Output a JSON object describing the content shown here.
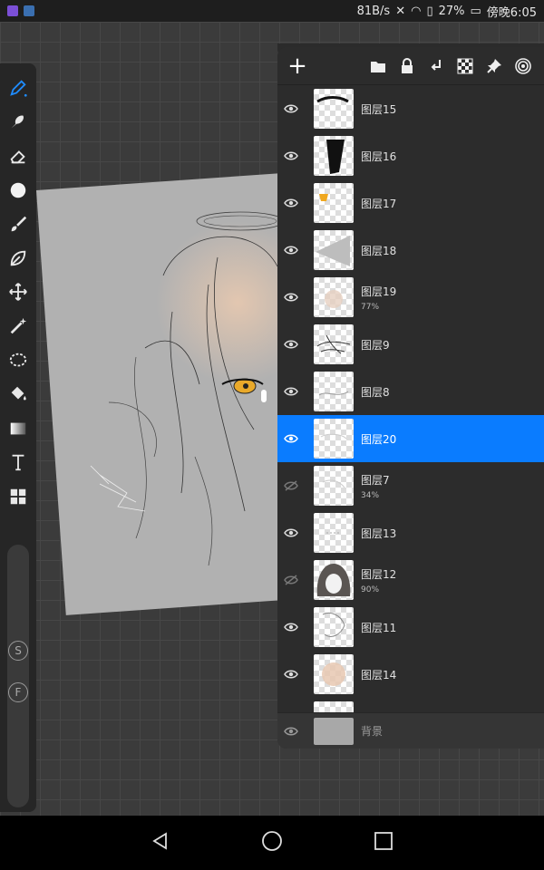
{
  "status_bar": {
    "net_speed": "81B/s",
    "battery": "27%",
    "time": "傍晚6:05"
  },
  "toolbar": {
    "tools": [
      "pen-icon",
      "smudge-icon",
      "eraser-icon",
      "brush-size-icon",
      "brush-icon",
      "leaf-icon",
      "move-icon",
      "magic-wand-icon",
      "lasso-icon",
      "fill-icon",
      "gradient-icon",
      "text-icon",
      "grid-icon"
    ],
    "s_label": "S",
    "f_label": "F"
  },
  "layer_panel": {
    "add_label": "+",
    "header_icons": [
      "folder-icon",
      "lock-icon",
      "merge-down-icon",
      "checker-icon",
      "pin-icon",
      "spiral-icon"
    ],
    "layers": [
      {
        "name": "图层15",
        "opacity": "",
        "visible": true,
        "selected": false
      },
      {
        "name": "图层16",
        "opacity": "",
        "visible": true,
        "selected": false
      },
      {
        "name": "图层17",
        "opacity": "",
        "visible": true,
        "selected": false
      },
      {
        "name": "图层18",
        "opacity": "",
        "visible": true,
        "selected": false
      },
      {
        "name": "图层19",
        "opacity": "77%",
        "visible": true,
        "selected": false
      },
      {
        "name": "图层9",
        "opacity": "",
        "visible": true,
        "selected": false
      },
      {
        "name": "图层8",
        "opacity": "",
        "visible": true,
        "selected": false
      },
      {
        "name": "图层20",
        "opacity": "",
        "visible": true,
        "selected": true
      },
      {
        "name": "图层7",
        "opacity": "34%",
        "visible": false,
        "selected": false
      },
      {
        "name": "图层13",
        "opacity": "",
        "visible": true,
        "selected": false
      },
      {
        "name": "图层12",
        "opacity": "90%",
        "visible": false,
        "selected": false
      },
      {
        "name": "图层11",
        "opacity": "",
        "visible": true,
        "selected": false
      },
      {
        "name": "图层14",
        "opacity": "",
        "visible": true,
        "selected": false
      }
    ],
    "background_layer": {
      "name": "背景",
      "visible": true
    }
  },
  "colors": {
    "accent": "#0a7cff",
    "panel": "#2c2c2c",
    "toolbar": "#262626",
    "canvas_bg": "#b1b1b1"
  }
}
